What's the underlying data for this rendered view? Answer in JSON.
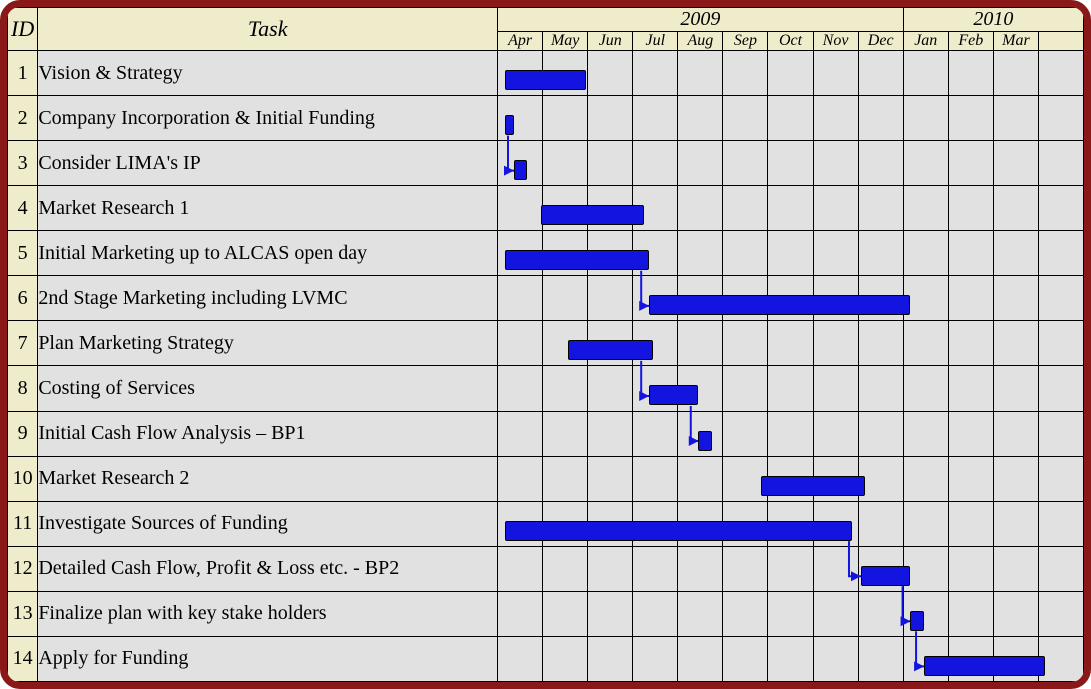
{
  "columns": {
    "id": "ID",
    "task": "Task"
  },
  "years": [
    {
      "label": "2009",
      "months": [
        "Apr",
        "May",
        "Jun",
        "Jul",
        "Aug",
        "Sep",
        "Oct",
        "Nov",
        "Dec"
      ]
    },
    {
      "label": "2010",
      "months": [
        "Jan",
        "Feb",
        "Mar",
        ""
      ]
    }
  ],
  "tasks": [
    {
      "id": "1",
      "name": "Vision & Strategy"
    },
    {
      "id": "2",
      "name": "Company Incorporation & Initial Funding"
    },
    {
      "id": "3",
      "name": "Consider LIMA's IP"
    },
    {
      "id": "4",
      "name": "Market Research 1"
    },
    {
      "id": "5",
      "name": "Initial Marketing up to ALCAS open day"
    },
    {
      "id": "6",
      "name": "2nd Stage Marketing including LVMC"
    },
    {
      "id": "7",
      "name": "Plan Marketing Strategy"
    },
    {
      "id": "8",
      "name": "Costing of Services"
    },
    {
      "id": "9",
      "name": "Initial Cash Flow Analysis – BP1"
    },
    {
      "id": "10",
      "name": "Market Research 2"
    },
    {
      "id": "11",
      "name": "Investigate Sources of Funding"
    },
    {
      "id": "12",
      "name": "Detailed Cash Flow, Profit & Loss etc. - BP2"
    },
    {
      "id": "13",
      "name": "Finalize plan with key stake holders"
    },
    {
      "id": "14",
      "name": "Apply for Funding"
    }
  ],
  "chart_data": {
    "type": "gantt",
    "time_axis": {
      "start": "2009-04",
      "end": "2010-04",
      "columns": [
        "2009-04",
        "2009-05",
        "2009-06",
        "2009-07",
        "2009-08",
        "2009-09",
        "2009-10",
        "2009-11",
        "2009-12",
        "2010-01",
        "2010-02",
        "2010-03",
        "2010-04"
      ]
    },
    "bars": [
      {
        "task": 1,
        "start_col": 0.0,
        "end_col": 1.8
      },
      {
        "task": 2,
        "start_col": 0.0,
        "end_col": 0.2
      },
      {
        "task": 3,
        "start_col": 0.2,
        "end_col": 0.5
      },
      {
        "task": 4,
        "start_col": 0.8,
        "end_col": 3.1
      },
      {
        "task": 5,
        "start_col": 0.0,
        "end_col": 3.2
      },
      {
        "task": 6,
        "start_col": 3.2,
        "end_col": 9.0
      },
      {
        "task": 7,
        "start_col": 1.4,
        "end_col": 3.3
      },
      {
        "task": 8,
        "start_col": 3.2,
        "end_col": 4.3
      },
      {
        "task": 9,
        "start_col": 4.3,
        "end_col": 4.6
      },
      {
        "task": 10,
        "start_col": 5.7,
        "end_col": 8.0
      },
      {
        "task": 11,
        "start_col": 0.0,
        "end_col": 7.7
      },
      {
        "task": 12,
        "start_col": 7.9,
        "end_col": 9.0
      },
      {
        "task": 13,
        "start_col": 9.0,
        "end_col": 9.3
      },
      {
        "task": 14,
        "start_col": 9.3,
        "end_col": 12.0
      }
    ],
    "dependencies": [
      {
        "from": 2,
        "to": 3
      },
      {
        "from": 5,
        "to": 6
      },
      {
        "from": 7,
        "to": 8
      },
      {
        "from": 8,
        "to": 9
      },
      {
        "from": 11,
        "to": 12
      },
      {
        "from": 12,
        "to": 13
      },
      {
        "from": 13,
        "to": 14
      }
    ]
  }
}
